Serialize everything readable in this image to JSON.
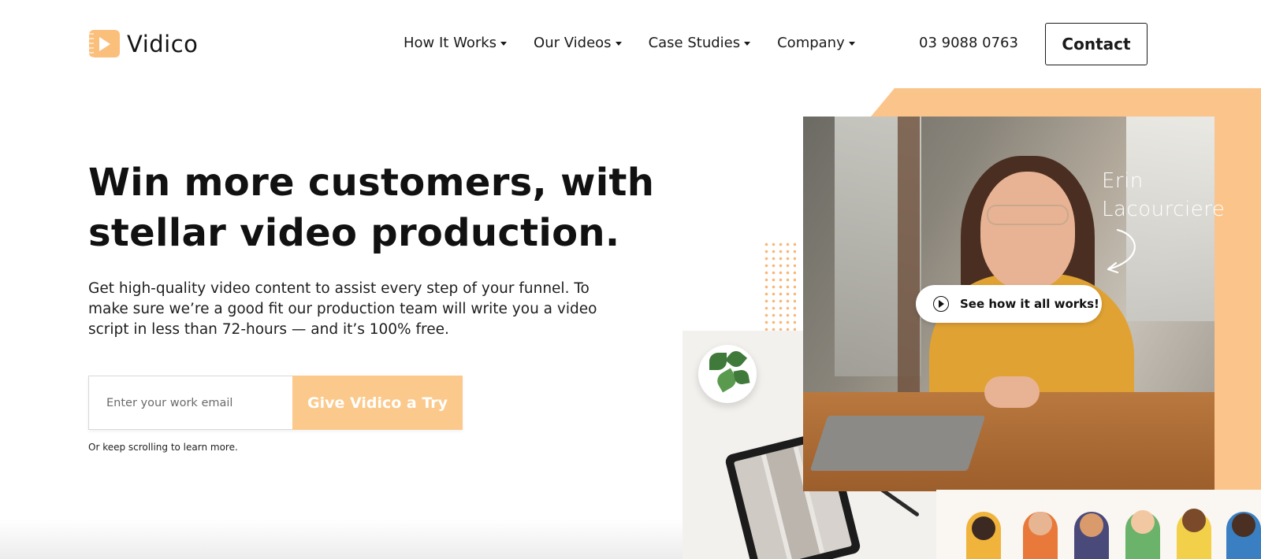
{
  "brand": {
    "name": "Vidico",
    "accent": "#fbc48a",
    "button_color": "#fbc98b"
  },
  "nav": {
    "items": [
      {
        "label": "How It Works"
      },
      {
        "label": "Our Videos"
      },
      {
        "label": "Case Studies"
      },
      {
        "label": "Company"
      }
    ],
    "phone": "03 9088 0763",
    "contact_label": "Contact"
  },
  "hero": {
    "headline_line1": "Win more customers, with",
    "headline_line2": "stellar video production.",
    "subcopy": "Get high-quality video content to assist every step of your funnel. To make sure we’re a good fit our production team will write you a video script in less than 72-hours — and it’s 100% free.",
    "email_placeholder": "Enter your work email",
    "cta_label": "Give Vidico a Try",
    "scroll_note": "Or keep scrolling to learn more."
  },
  "video": {
    "person_name_line1": "Erin",
    "person_name_line2": "Lacourciere",
    "play_label": "See how it all works!",
    "icon": "play-circle-icon"
  }
}
